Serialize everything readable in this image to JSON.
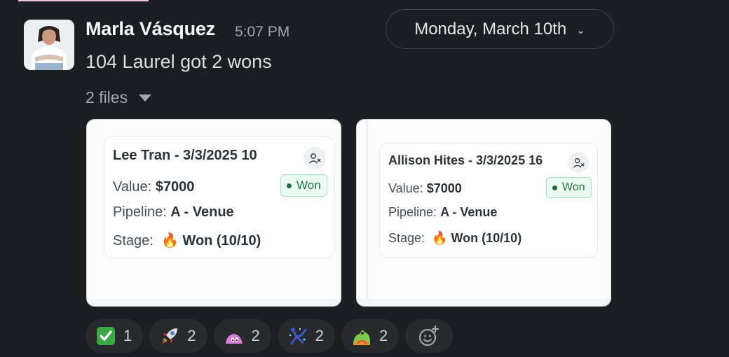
{
  "message": {
    "sender": "Marla Vásquez",
    "timestamp": "5:07 PM",
    "text": "104 Laurel got 2 wons",
    "files_label": "2 files"
  },
  "date_divider": {
    "label": "Monday, March 10th",
    "chevron": "⌄"
  },
  "files": [
    {
      "name": "Lee Tran - 3/3/2025 10",
      "value_label": "Value:",
      "value": "$7000",
      "pipeline_label": "Pipeline:",
      "pipeline": "A - Venue",
      "stage_label": "Stage:",
      "stage_icon": "🔥",
      "stage": "Won (10/10)",
      "status": "Won"
    },
    {
      "name": "Allison Hites - 3/3/2025 16",
      "value_label": "Value:",
      "value": "$7000",
      "pipeline_label": "Pipeline:",
      "pipeline": "A - Venue",
      "stage_label": "Stage:",
      "stage_icon": "🔥",
      "stage": "Won (10/10)",
      "status": "Won"
    }
  ],
  "reactions": [
    {
      "emoji": "white-check-mark",
      "count": "1"
    },
    {
      "emoji": "rocket",
      "count": "2"
    },
    {
      "emoji": "pink-blob",
      "count": "2"
    },
    {
      "emoji": "sparkle-dancer",
      "count": "2"
    },
    {
      "emoji": "party-frog",
      "count": "2"
    }
  ],
  "colors": {
    "background": "#1a1d21",
    "won_green": "#1f6f43",
    "pill_bg": "#27292d"
  }
}
